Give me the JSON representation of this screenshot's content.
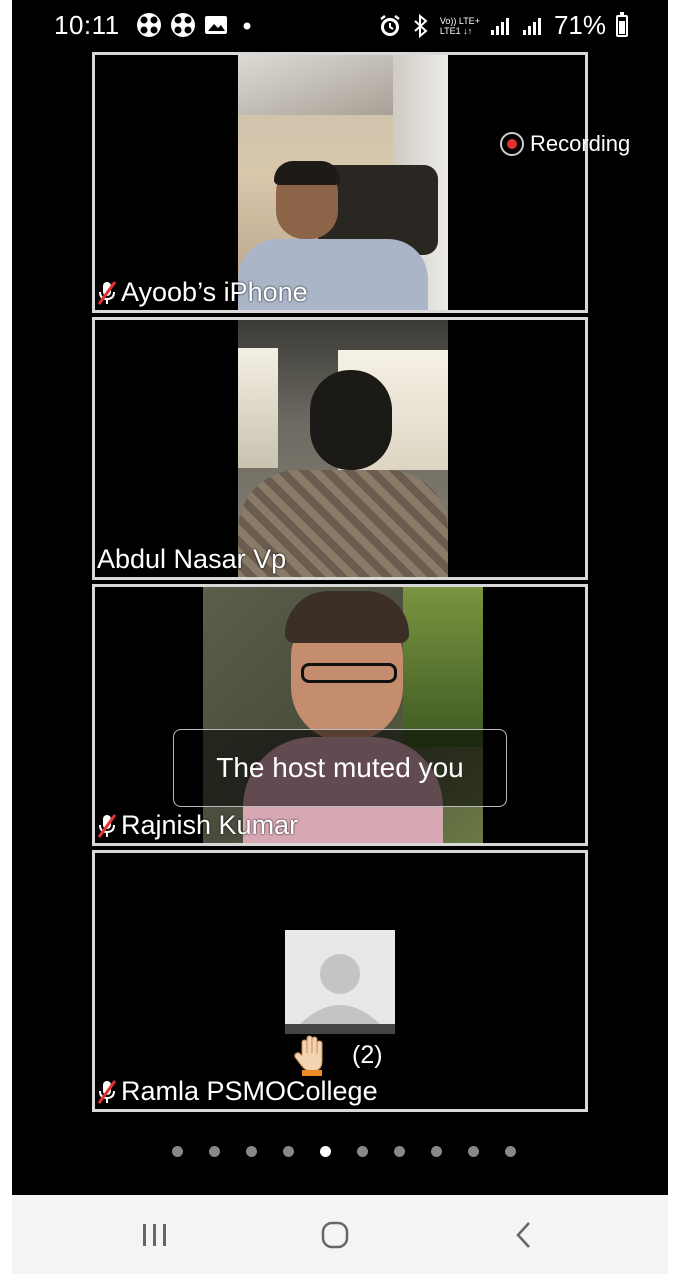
{
  "status_bar": {
    "time": "10:11",
    "left_icons": [
      "pinwheel-icon",
      "pinwheel-icon",
      "image-icon",
      "dot-icon"
    ],
    "right_icons": [
      "alarm-icon",
      "bluetooth-icon",
      "volte-icon",
      "signal-icon",
      "signal-icon"
    ],
    "volte_line1": "Vo)) LTE+",
    "volte_line2": "LTE1 ↓↑",
    "battery_percent": "71%"
  },
  "recording_label": "Recording",
  "participants": [
    {
      "name": "Ayoob’s iPhone",
      "muted": true
    },
    {
      "name": "Abdul Nasar Vp",
      "muted": false
    },
    {
      "name": "Rajnish Kumar",
      "muted": true
    },
    {
      "name": "Ramla PSMOCollege",
      "muted": true
    }
  ],
  "toast": "The host muted you",
  "raised_hand_count": "(2)",
  "pager": {
    "count": 10,
    "active_index": 4
  },
  "nav": [
    "recent-apps-icon",
    "home-icon",
    "back-icon"
  ],
  "colors": {
    "recording": "#e53030",
    "background": "#000000"
  }
}
